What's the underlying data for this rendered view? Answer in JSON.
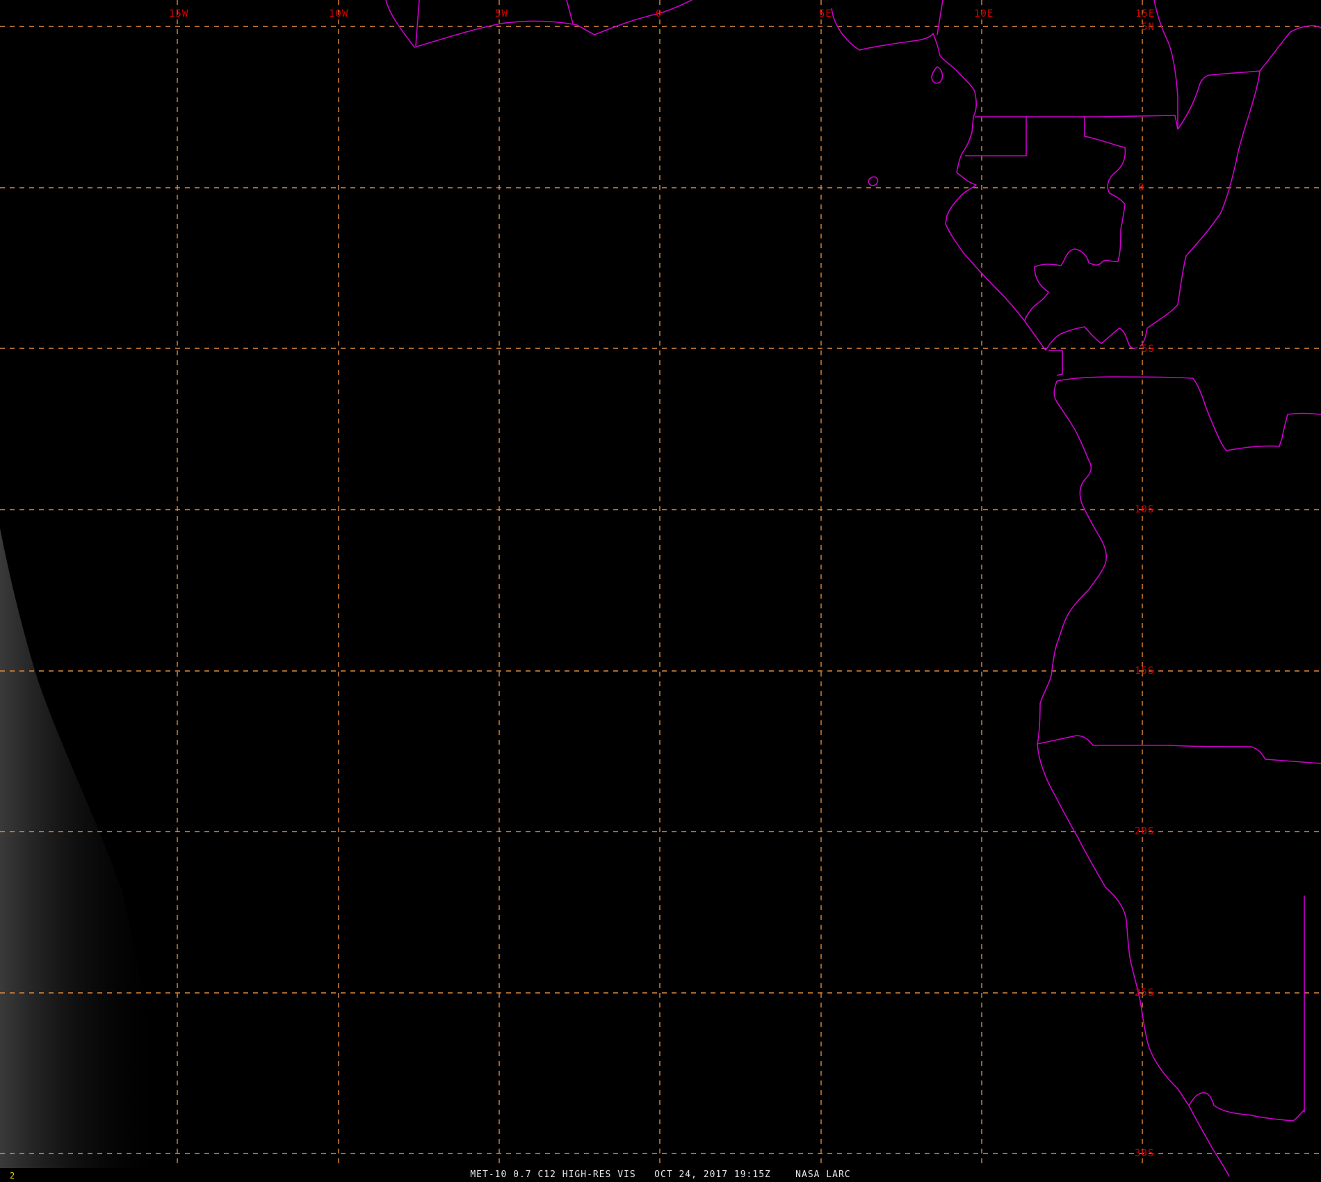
{
  "caption": "MET-10 0.7 C12 HIGH-RES VIS   OCT 24, 2017 19:15Z    NASA LARC",
  "frame_number": "2",
  "colors": {
    "background": "#000000",
    "graticule": "#e08a3c",
    "graticule_label": "#d40000",
    "coastline": "#cc00cc",
    "caption": "#e6e6e6",
    "frame_number": "#e6d800"
  },
  "longitude_labels": [
    "15W",
    "10W",
    "5W",
    "0",
    "5E",
    "10E",
    "15E"
  ],
  "latitude_labels": [
    "5N",
    "0",
    "5S",
    "10S",
    "15S",
    "20S",
    "25S",
    "30S"
  ]
}
